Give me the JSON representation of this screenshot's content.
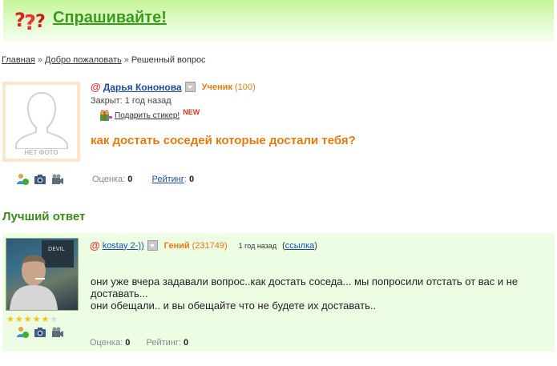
{
  "header": {
    "title": "Спрашивайте!",
    "logo_icon": "question-marks-logo-icon"
  },
  "breadcrumb": {
    "home": "Главная",
    "welcome": "Добро пожаловать",
    "current": "Решенный вопрос",
    "separator": "»"
  },
  "question": {
    "photo_placeholder": "НЕТ ФОТО",
    "author": "Дарья Кононова",
    "rank": "Ученик",
    "points": "(100)",
    "closed": "Закрыт: 1 год назад",
    "gift_label": "Подарить стикер!",
    "new_badge": "NEW",
    "text": "как достать соседей которые достали тебя?",
    "rating_label": "Оценка:",
    "rating_value": "0",
    "score_label": "Рейтинг",
    "score_value": "0"
  },
  "best_answer": {
    "heading": "Лучший ответ",
    "author": "kostay 2-))",
    "rank": "Гений",
    "points": "(231749)",
    "time": "1 год назад",
    "link_label": "ссылка",
    "stars_filled": 5,
    "stars_total": 6,
    "text_line1": "они уже вчера задавали вопрос..как достать соседа... мы попросили отстать от вас и не доставать...",
    "text_line2": "они обещали.. и вы обещайте что не будете их доставать..",
    "rating_label": "Оценка:",
    "rating_value": "0",
    "score_label": "Рейтинг:",
    "score_value": "0"
  },
  "colors": {
    "accent_green": "#3a9a1c",
    "accent_orange": "#e07b13",
    "answer_bg": "#edfde4",
    "link_blue": "#1a4ea2"
  }
}
